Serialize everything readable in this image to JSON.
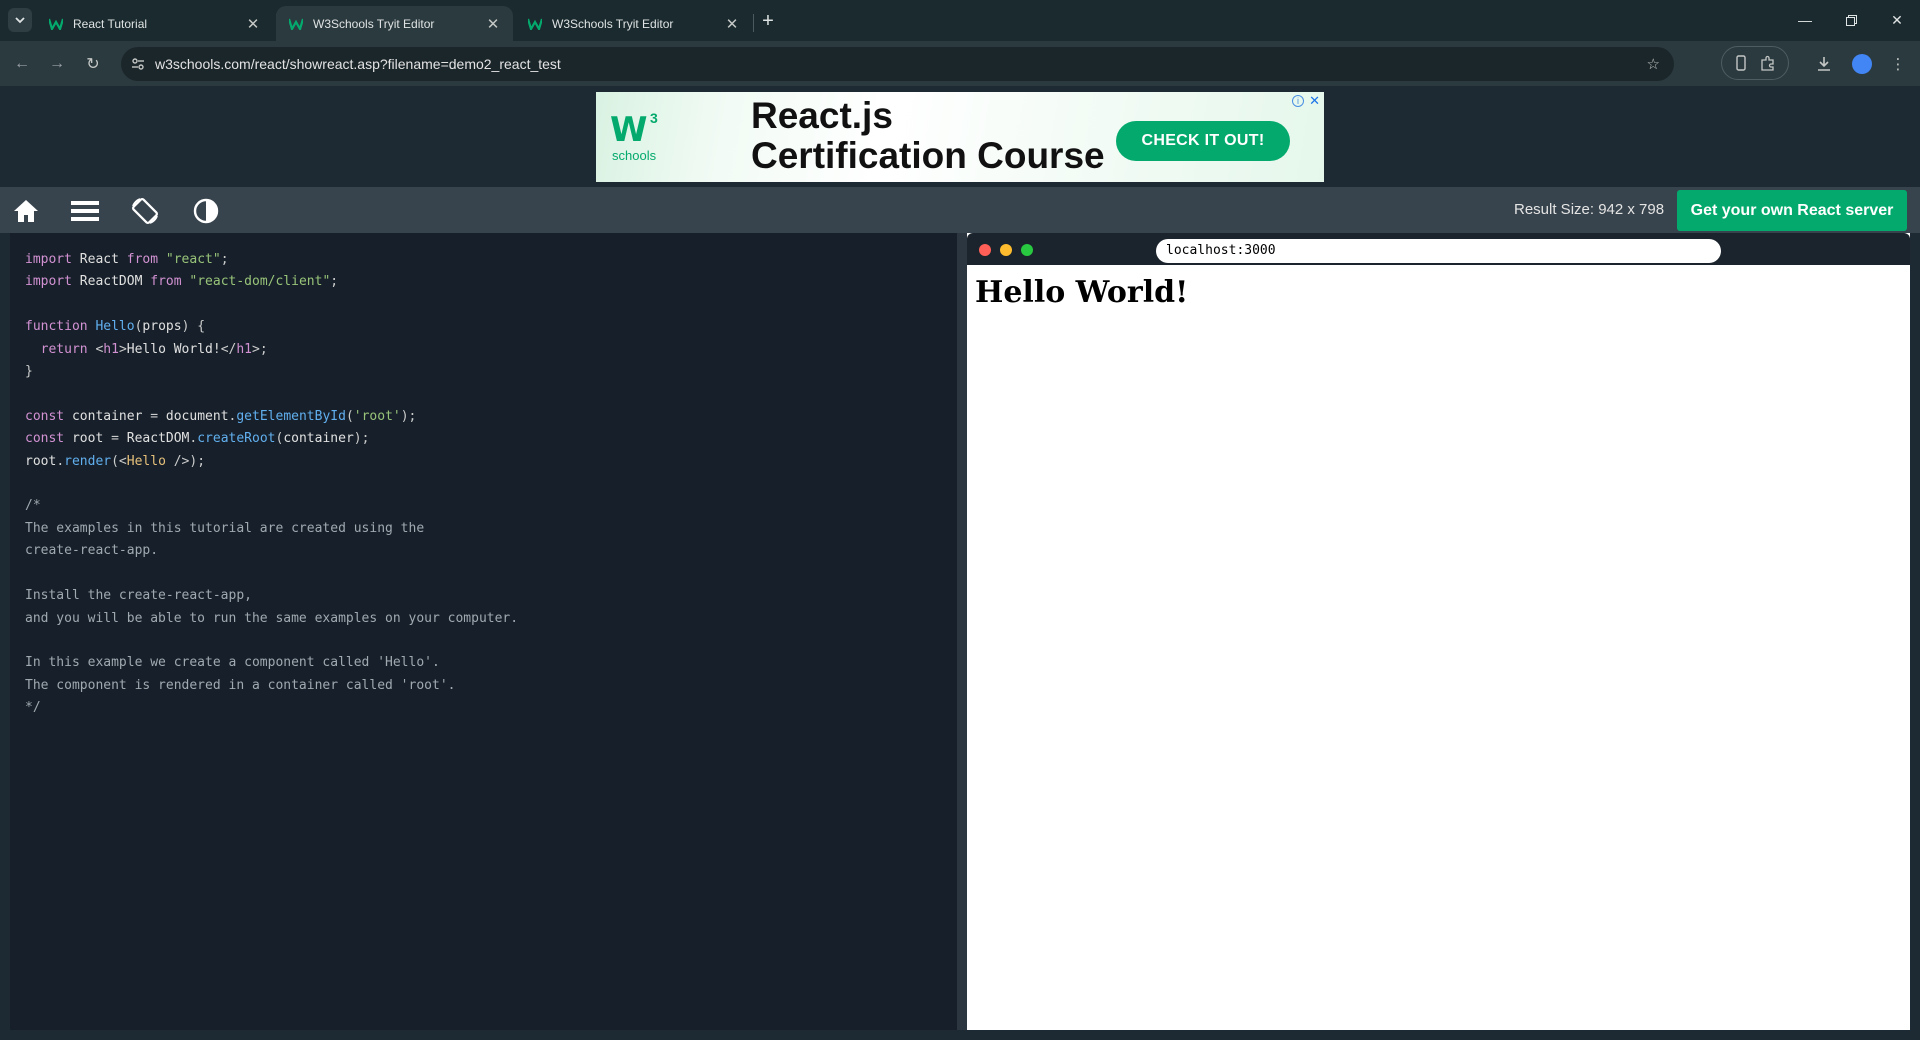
{
  "browser": {
    "tabs": [
      {
        "title": "React Tutorial",
        "active": false
      },
      {
        "title": "W3Schools Tryit Editor",
        "active": true
      },
      {
        "title": "W3Schools Tryit Editor",
        "active": false
      }
    ],
    "url": "w3schools.com/react/showreact.asp?filename=demo2_react_test"
  },
  "ad": {
    "logo_letter": "W",
    "logo_superscript": "3",
    "logo_word": "schools",
    "headline_line1": "React.js",
    "headline_line2": "Certification Course",
    "cta": "CHECK IT OUT!"
  },
  "tryit_toolbar": {
    "result_size": "Result Size: 942 x 798",
    "server_button": "Get your own React server"
  },
  "preview": {
    "url": "localhost:3000",
    "heading": "Hello World!"
  },
  "colors": {
    "brand_green": "#04aa6d",
    "editor_bg": "#17202a",
    "page_bg": "#1e2a33"
  },
  "code_lines": [
    "import React from \"react\";",
    "import ReactDOM from \"react-dom/client\";",
    "",
    "function Hello(props) {",
    "  return <h1>Hello World!</h1>;",
    "}",
    "",
    "const container = document.getElementById('root');",
    "const root = ReactDOM.createRoot(container);",
    "root.render(<Hello />);",
    "",
    "/*",
    "The examples in this tutorial are created using the",
    "create-react-app.",
    "",
    "Install the create-react-app,",
    "and you will be able to run the same examples on your computer.",
    "",
    "In this example we create a component called 'Hello'.",
    "The component is rendered in a container called 'root'.",
    "*/"
  ]
}
